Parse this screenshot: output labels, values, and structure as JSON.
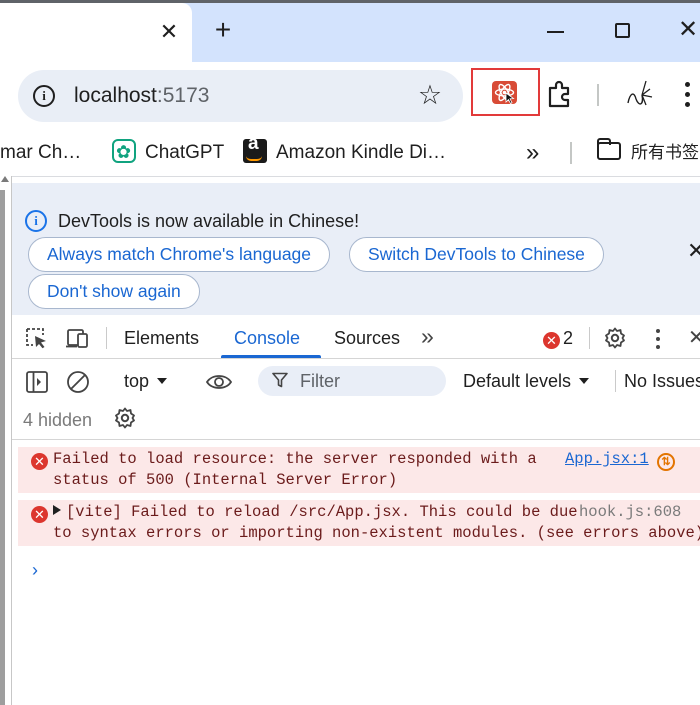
{
  "browser": {
    "tab": {
      "close_glyph": "✕"
    },
    "new_tab_glyph": "+",
    "window": {
      "close_glyph": "✕"
    },
    "omnibox": {
      "url_host": "localhost",
      "url_port": ":5173"
    },
    "bookmarks": [
      {
        "label": "mar Ch…",
        "icon": "bookmark-favicon-cut"
      },
      {
        "label": "ChatGPT",
        "icon": "chatgpt-icon"
      },
      {
        "label": "Amazon Kindle Di…",
        "icon": "amazon-icon"
      }
    ],
    "bookmarks_more_glyph": "»",
    "bookmarks_folder_label": "所有书签",
    "colors": {
      "tabstrip_bg": "#d3e3fd",
      "omnibox_bg": "#e9eef6",
      "highlight_border": "#e23a3a"
    }
  },
  "devtools": {
    "infobar": {
      "message": "DevTools is now available in Chinese!",
      "buttons": [
        "Always match Chrome's language",
        "Switch DevTools to Chinese",
        "Don't show again"
      ],
      "close_glyph": "✕"
    },
    "tabs": [
      {
        "label": "Elements",
        "active": false
      },
      {
        "label": "Console",
        "active": true
      },
      {
        "label": "Sources",
        "active": false
      }
    ],
    "more_tabs_glyph": "»",
    "error_count": "2",
    "error_glyph": "✕",
    "close_glyph": "✕",
    "console_toolbar": {
      "context": "top",
      "filter_placeholder": "Filter",
      "levels": "Default levels",
      "issues": "No Issues"
    },
    "hidden_count_text": "4 hidden",
    "messages": [
      {
        "level": "error",
        "line1": "Failed to load resource: the server responded with a",
        "line2": "status of 500 (Internal Server Error)",
        "source": "App.jsx:1"
      },
      {
        "level": "error",
        "line1": "[vite] Failed to reload /src/App.jsx. This could be due",
        "line2": "to syntax errors or importing non-existent modules. (see errors above)",
        "source": "hook.js:608"
      }
    ],
    "prompt_glyph": "›",
    "colors": {
      "accent": "#1a67d2",
      "error": "#dc362e",
      "error_row_bg": "#fce8e8",
      "infobar_bg": "#e9eef7"
    }
  }
}
